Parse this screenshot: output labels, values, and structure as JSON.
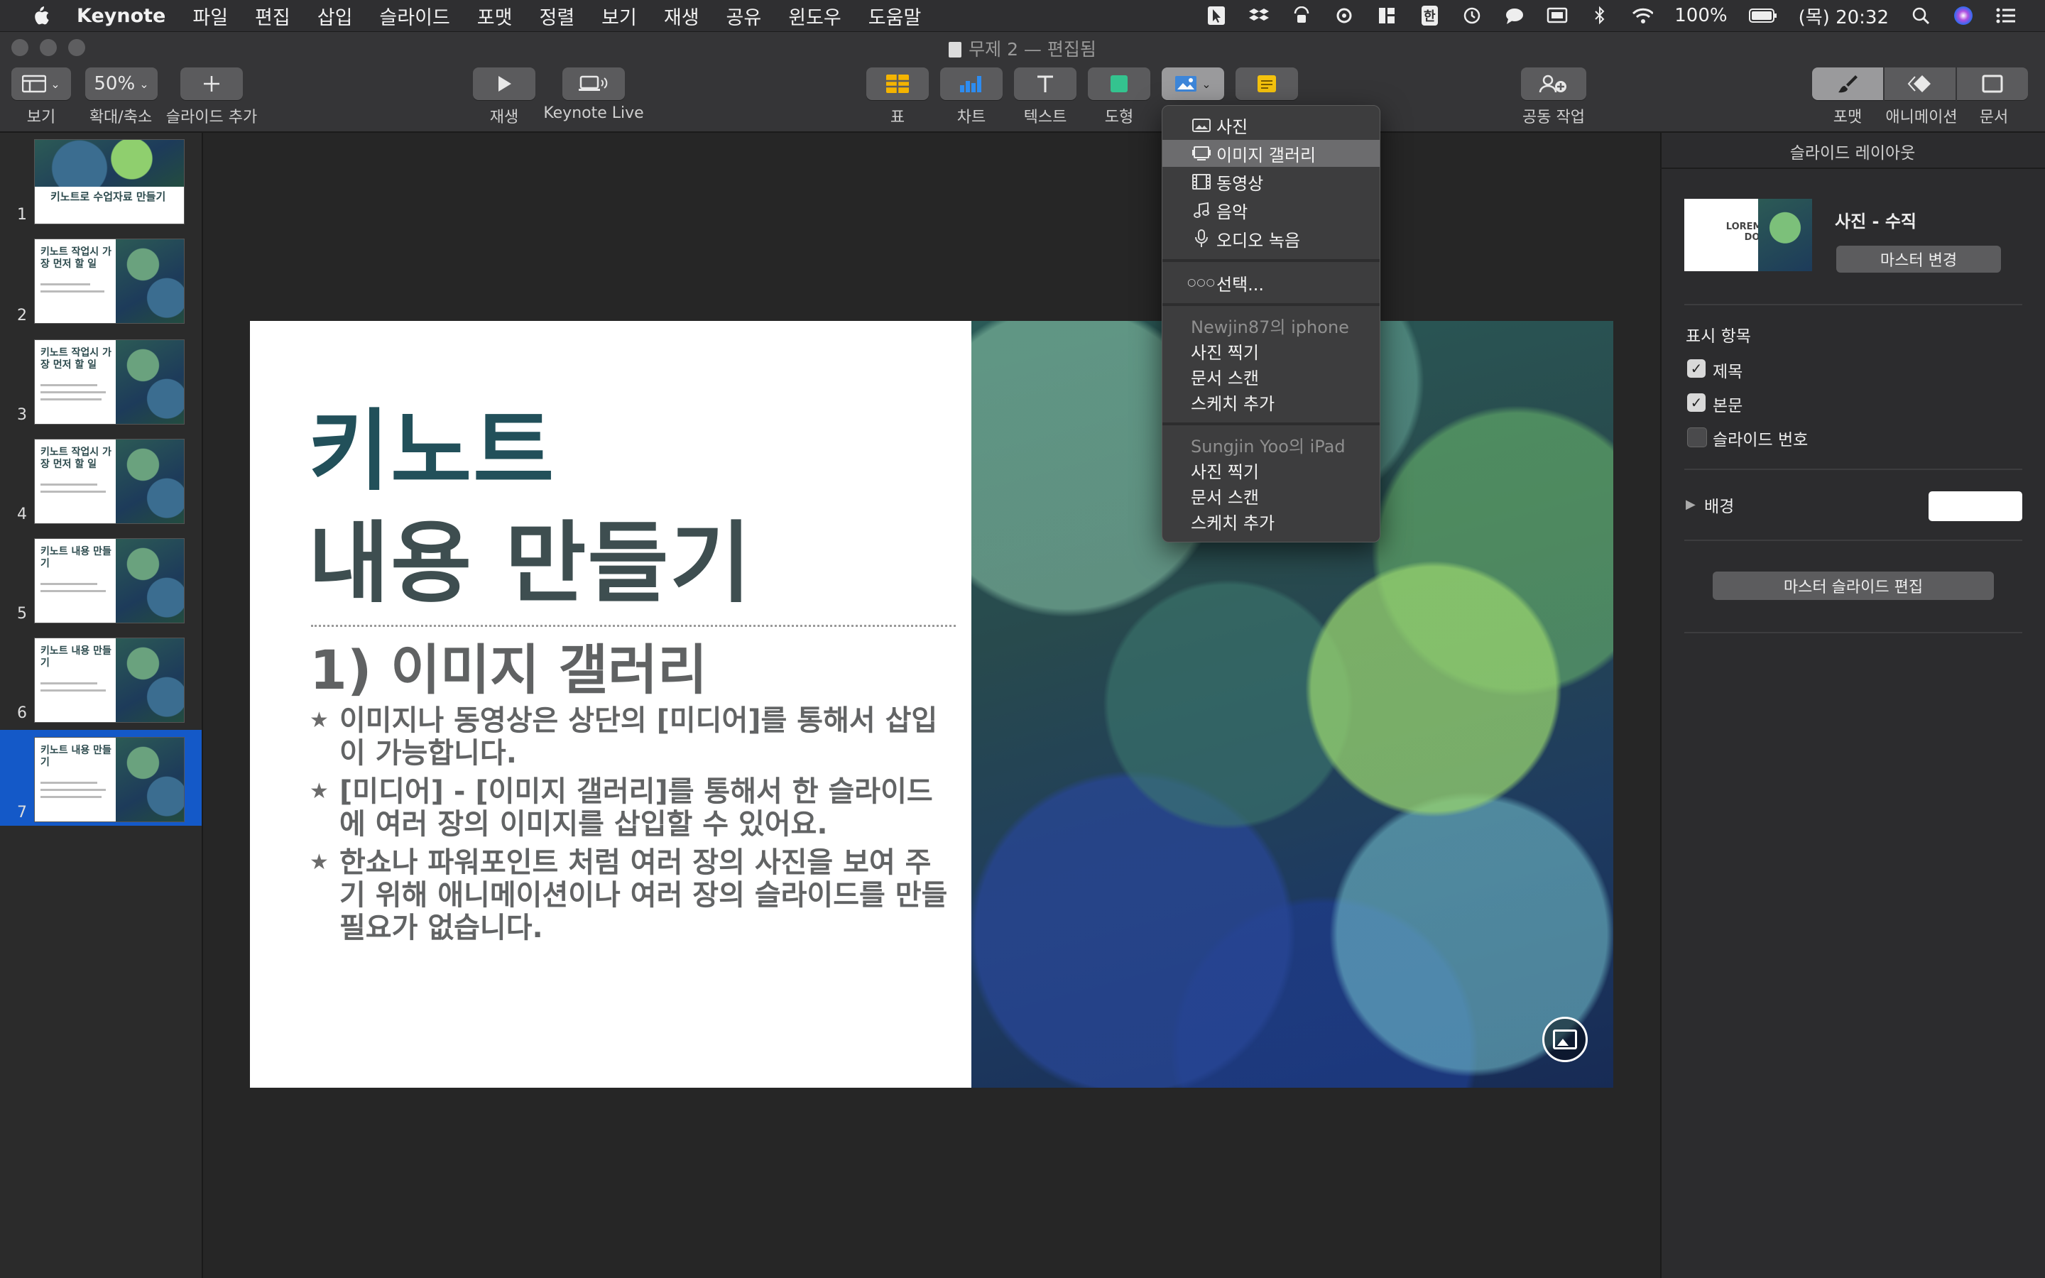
{
  "menubar": {
    "app_name": "Keynote",
    "items": [
      "파일",
      "편집",
      "삽입",
      "슬라이드",
      "포맷",
      "정렬",
      "보기",
      "재생",
      "공유",
      "윈도우",
      "도움말"
    ],
    "battery": "100%",
    "clock": "(목) 20:32",
    "input_source": "한"
  },
  "window": {
    "title": "무제 2 — 편집됨"
  },
  "toolbar": {
    "view_label": "보기",
    "zoom_value": "50%",
    "zoom_label": "확대/축소",
    "add_slide_label": "슬라이드 추가",
    "play_label": "재생",
    "keynote_live_label": "Keynote Live",
    "table_label": "표",
    "chart_label": "차트",
    "text_label": "텍스트",
    "shape_label": "도형",
    "collab_label": "공동 작업",
    "format_label": "포맷",
    "animate_label": "애니메이션",
    "document_label": "문서"
  },
  "media_menu": {
    "items": [
      "사진",
      "이미지 갤러리",
      "동영상",
      "음악",
      "오디오 녹음"
    ],
    "choose": "선택...",
    "devices": [
      {
        "name": "Newjin87의 iphone",
        "actions": [
          "사진 찍기",
          "문서 스캔",
          "스케치 추가"
        ]
      },
      {
        "name": "Sungjin Yoo의 iPad",
        "actions": [
          "사진 찍기",
          "문서 스캔",
          "스케치 추가"
        ]
      }
    ]
  },
  "navigator": {
    "slides": [
      {
        "num": "1",
        "title": "키노트로 수업자료 만들기"
      },
      {
        "num": "2",
        "title": "키노트 작업시 가장 먼저 할 일"
      },
      {
        "num": "3",
        "title": "키노트 작업시 가장 먼저 할 일"
      },
      {
        "num": "4",
        "title": "키노트 작업시 가장 먼저 할 일"
      },
      {
        "num": "5",
        "title": "키노트 내용 만들기"
      },
      {
        "num": "6",
        "title": "키노트 내용 만들기"
      },
      {
        "num": "7",
        "title": "키노트 내용 만들기"
      }
    ]
  },
  "slide": {
    "title_line1": "키노트",
    "title_line2": "내용 만들기",
    "subtitle": "1) 이미지 갤러리",
    "bullets": [
      "이미지나 동영상은 상단의 [미디어]를 통해서 삽입이 가능합니다.",
      "[미디어] - [이미지 갤러리]를 통해서 한 슬라이드에 여러 장의 이미지를 삽입할 수 있어요.",
      "한쇼나 파워포인트 처럼 여러 장의 사진을 보여 주기 위해 애니메이션이나 여러 장의 슬라이드를 만들 필요가 없습니다."
    ]
  },
  "inspector": {
    "title": "슬라이드 레이아웃",
    "layout_name": "사진 - 수직",
    "layout_thumb_text": "LOREM IPSUM DOLOR",
    "master_change": "마스터 변경",
    "show_heading": "표시 항목",
    "checkboxes": [
      {
        "label": "제목",
        "checked": true
      },
      {
        "label": "본문",
        "checked": true
      },
      {
        "label": "슬라이드 번호",
        "checked": false
      }
    ],
    "background_label": "배경",
    "background_color": "#FFFFFF",
    "edit_master": "마스터 슬라이드 편집"
  },
  "colors": {
    "accent_selected": "#1459C8",
    "title_teal": "#22505A"
  }
}
